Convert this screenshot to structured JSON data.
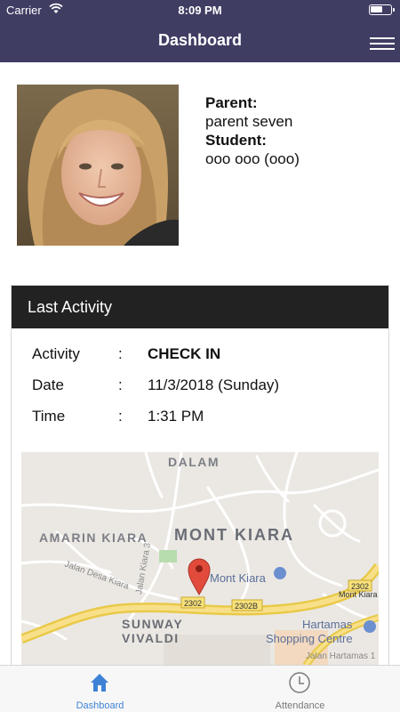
{
  "status_bar": {
    "carrier": "Carrier",
    "time": "8:09 PM"
  },
  "nav": {
    "title": "Dashboard"
  },
  "profile": {
    "parent_label": "Parent:",
    "parent_name": "parent seven",
    "student_label": "Student:",
    "student_name": "ooo ooo (ooo)"
  },
  "last_activity": {
    "title": "Last Activity",
    "separator": ":",
    "rows": [
      {
        "label": "Activity",
        "value": "CHECK IN"
      },
      {
        "label": "Date",
        "value": "11/3/2018 (Sunday)"
      },
      {
        "label": "Time",
        "value": "1:31 PM"
      }
    ]
  },
  "map": {
    "labels": {
      "dalam": "DALAM",
      "amarin": "AMARIN KIARA",
      "mont_kiara": "MONT KIARA",
      "mont_kiara_poi": "Mont Kiara",
      "jalan_desa": "Jalan Desa Kiara",
      "jalan_kiara": "Jalan Kiara 3",
      "sunway": "SUNWAY",
      "vivaldi": "VIVALDI",
      "hartamas": "Hartamas",
      "shopping": "Shopping Centre",
      "hartamas1": "Jalan Hartamas 1",
      "r2302a": "2302",
      "r2302b": "2302B",
      "r2302c": "2302",
      "mont_kiara_right": "Mont Kiara"
    }
  },
  "tabs": [
    {
      "label": "Dashboard",
      "icon": "home-icon",
      "active": true
    },
    {
      "label": "Attendance",
      "icon": "clock-icon",
      "active": false
    }
  ],
  "colors": {
    "nav_bg": "#403d63",
    "card_header": "#222222",
    "tab_active": "#3e82d6",
    "tab_inactive": "#7a7a7a"
  }
}
